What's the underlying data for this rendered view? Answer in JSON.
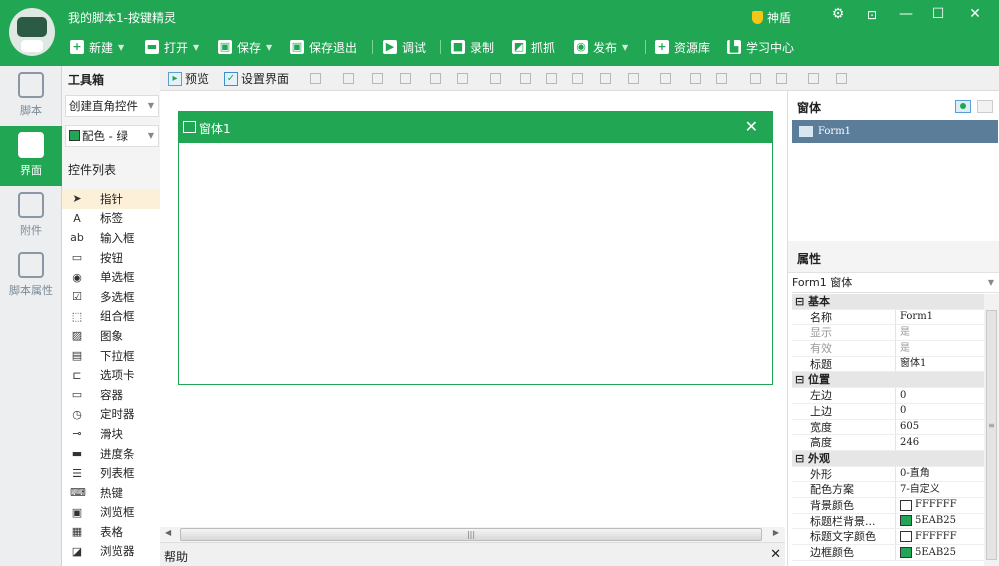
{
  "app": {
    "title": "我的脚本1-按键精灵"
  },
  "header": {
    "shield_label": "神盾",
    "toolbar": [
      {
        "label": "新建",
        "icon": "plus-icon",
        "dropdown": true
      },
      {
        "label": "打开",
        "icon": "folder-icon",
        "dropdown": true
      },
      {
        "label": "保存",
        "icon": "save-icon",
        "dropdown": true
      },
      {
        "label": "保存退出",
        "icon": "save-exit-icon",
        "dropdown": false
      },
      {
        "label": "调试",
        "icon": "play-icon",
        "dropdown": false
      },
      {
        "label": "录制",
        "icon": "camera-icon",
        "dropdown": false
      },
      {
        "label": "抓抓",
        "icon": "grab-icon",
        "dropdown": false
      },
      {
        "label": "发布",
        "icon": "publish-icon",
        "dropdown": true
      },
      {
        "label": "资源库",
        "icon": "resource-icon",
        "dropdown": false
      },
      {
        "label": "学习中心",
        "icon": "learn-icon",
        "dropdown": false
      }
    ]
  },
  "leftnav": [
    {
      "label": "脚本",
      "icon": "code-file-icon",
      "active": false
    },
    {
      "label": "界面",
      "icon": "grid-icon",
      "active": true
    },
    {
      "label": "附件",
      "icon": "attachment-icon",
      "active": false
    },
    {
      "label": "脚本属性",
      "icon": "info-icon",
      "active": false
    }
  ],
  "toolbox": {
    "title": "工具箱",
    "create_select": "创建直角控件",
    "color_select": "配色 - 绿",
    "list_label": "控件列表",
    "items": [
      {
        "label": "指针",
        "icon": "pointer-icon",
        "glyph": "➤"
      },
      {
        "label": "标签",
        "icon": "label-icon",
        "glyph": "A"
      },
      {
        "label": "输入框",
        "icon": "textbox-icon",
        "glyph": "ab"
      },
      {
        "label": "按钮",
        "icon": "button-icon",
        "glyph": "▭"
      },
      {
        "label": "单选框",
        "icon": "radio-icon",
        "glyph": "◉"
      },
      {
        "label": "多选框",
        "icon": "checkbox-icon",
        "glyph": "☑"
      },
      {
        "label": "组合框",
        "icon": "groupbox-icon",
        "glyph": "⬚"
      },
      {
        "label": "图象",
        "icon": "image-icon",
        "glyph": "▨"
      },
      {
        "label": "下拉框",
        "icon": "combobox-icon",
        "glyph": "▤"
      },
      {
        "label": "选项卡",
        "icon": "tab-icon",
        "glyph": "⊏"
      },
      {
        "label": "容器",
        "icon": "container-icon",
        "glyph": "▭"
      },
      {
        "label": "定时器",
        "icon": "timer-icon",
        "glyph": "◷"
      },
      {
        "label": "滑块",
        "icon": "slider-icon",
        "glyph": "⊸"
      },
      {
        "label": "进度条",
        "icon": "progress-icon",
        "glyph": "▬"
      },
      {
        "label": "列表框",
        "icon": "listbox-icon",
        "glyph": "☰"
      },
      {
        "label": "热键",
        "icon": "hotkey-icon",
        "glyph": "⌨"
      },
      {
        "label": "浏览框",
        "icon": "browse-icon",
        "glyph": "▣"
      },
      {
        "label": "表格",
        "icon": "table-icon",
        "glyph": "▦"
      },
      {
        "label": "浏览器",
        "icon": "browser-icon",
        "glyph": "◪"
      }
    ]
  },
  "designer_toolbar": {
    "preview": "预览",
    "set_ui": "设置界面"
  },
  "form": {
    "title": "窗体1",
    "close": "✕"
  },
  "help": {
    "title": "帮助",
    "close": "✕"
  },
  "form_panel": {
    "title": "窗体",
    "items": [
      "Form1"
    ]
  },
  "properties": {
    "title": "属性",
    "object": "Form1 窗体",
    "rows": [
      {
        "type": "section",
        "key": "⊟ 基本"
      },
      {
        "key": "名称",
        "value": "Form1"
      },
      {
        "key": "显示",
        "value": "是",
        "dim": true
      },
      {
        "key": "有效",
        "value": "是",
        "dim": true
      },
      {
        "key": "标题",
        "value": "窗体1"
      },
      {
        "type": "section",
        "key": "⊟ 位置"
      },
      {
        "key": "左边",
        "value": "0"
      },
      {
        "key": "上边",
        "value": "0"
      },
      {
        "key": "宽度",
        "value": "605"
      },
      {
        "key": "高度",
        "value": "246"
      },
      {
        "type": "section",
        "key": "⊟ 外观"
      },
      {
        "key": "外形",
        "value": "0-直角"
      },
      {
        "key": "配色方案",
        "value": "7-自定义"
      },
      {
        "key": "背景颜色",
        "value": "FFFFFF",
        "color": "#FFFFFF"
      },
      {
        "key": "标题栏背景...",
        "value": "5EAB25",
        "color": "#21A653"
      },
      {
        "key": "标题文字颜色",
        "value": "FFFFFF",
        "color": "#FFFFFF"
      },
      {
        "key": "边框颜色",
        "value": "5EAB25",
        "color": "#21A653"
      }
    ]
  },
  "colors": {
    "brand": "#21a653",
    "selected_row": "#5b7d9a"
  }
}
